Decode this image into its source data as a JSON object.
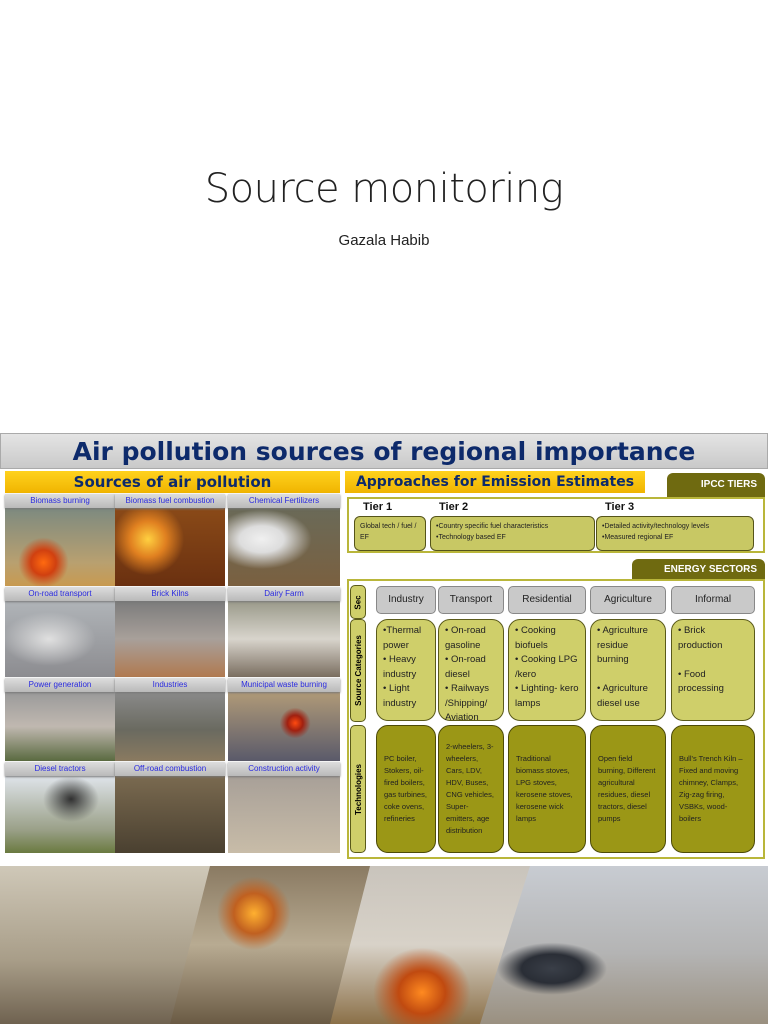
{
  "slide1": {
    "title": "Source monitoring",
    "author": "Gazala Habib"
  },
  "slide2": {
    "title": "Air pollution sources of regional importance",
    "left_header": "Sources of air pollution",
    "sources": [
      "Biomass burning",
      "Biomass fuel combustion",
      "Chemical Fertilizers",
      "On-road transport",
      "Brick Kilns",
      "Dairy Farm",
      "Power generation",
      "Industries",
      "Municipal waste burning",
      "Diesel tractors",
      "Off-road combustion",
      "Construction activity"
    ],
    "right_header": "Approaches for Emission Estimates",
    "ipcc_tab": "IPCC TIERS",
    "tiers": [
      {
        "name": "Tier 1",
        "text": "Global tech / fuel / EF"
      },
      {
        "name": "Tier 2",
        "text": "•Country specific fuel characteristics\n•Technology based EF"
      },
      {
        "name": "Tier 3",
        "text": "•Detailed activity/technology levels\n•Measured regional EF"
      }
    ],
    "energy_tab": "ENERGY SECTORS",
    "sec_label": "Sec",
    "source_categories_label": "Source Categories",
    "technologies_label": "Technologies",
    "sectors": [
      {
        "name": "Industry",
        "categories": "•Thermal power\n• Heavy industry\n• Light industry",
        "technologies": "PC boiler, Stokers, oil-fired boilers, gas turbines, coke ovens, refineries"
      },
      {
        "name": "Transport",
        "categories": "• On-road gasoline\n• On-road diesel\n• Railways /Shipping/ Aviation",
        "technologies": "2-wheelers, 3-wheelers, Cars, LDV, HDV, Buses, CNG vehicles, Super-emitters, age distribution"
      },
      {
        "name": "Residential",
        "categories": "• Cooking biofuels\n• Cooking LPG /kero\n• Lighting- kero lamps",
        "technologies": "Traditional biomass stoves, LPG stoves, kerosene stoves, kerosene wick lamps"
      },
      {
        "name": "Agriculture",
        "categories": "• Agriculture residue burning\n\n• Agriculture diesel use",
        "technologies": "Open field burning, Different agricultural residues, diesel tractors, diesel pumps"
      },
      {
        "name": "Informal",
        "categories": "• Brick production\n\n• Food processing",
        "technologies": "Bull's Trench Kiln – Fixed and moving chimney, Clamps, Zig-zag firing, VSBKs, wood-boilers"
      }
    ]
  }
}
